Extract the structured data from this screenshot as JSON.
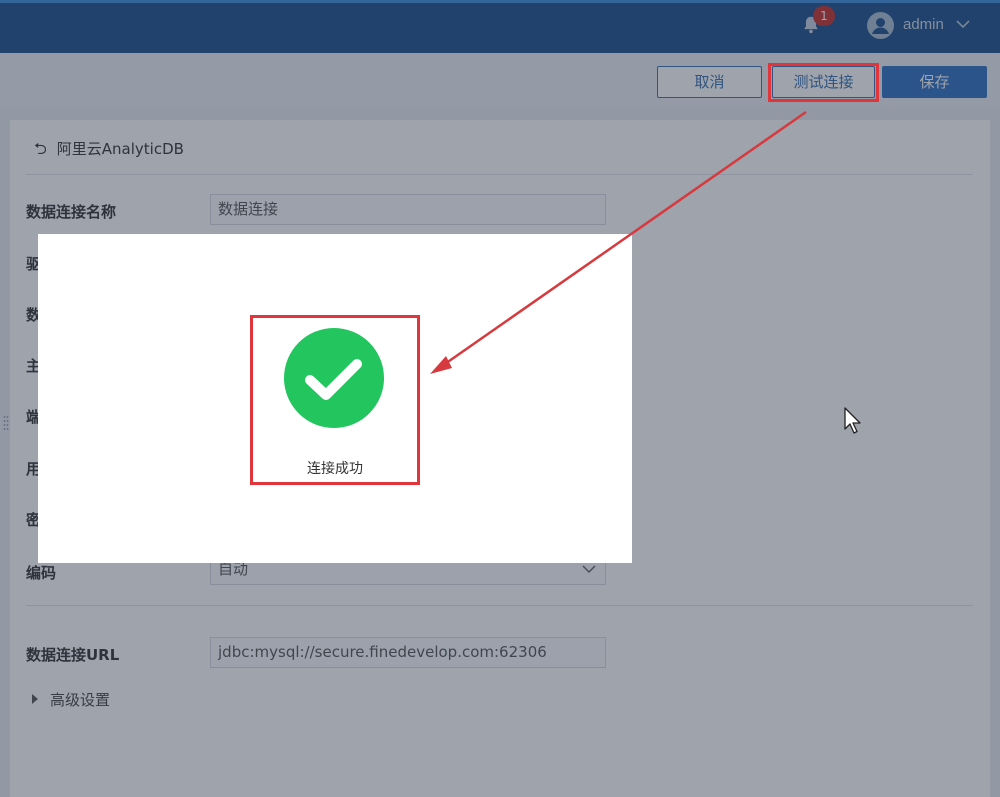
{
  "header": {
    "notification_count": "1",
    "username": "admin",
    "icons": {
      "bell": "bell-icon",
      "avatar": "user-avatar-icon",
      "chevron": "chevron-down-icon"
    }
  },
  "actions": {
    "cancel_label": "取消",
    "test_label": "测试连接",
    "save_label": "保存"
  },
  "form": {
    "back_label": "阿里云AnalyticDB",
    "name_label": "数据连接名称",
    "name_value": "数据连接",
    "partial_labels": [
      "驱",
      "数",
      "主",
      "端",
      "用",
      "密"
    ],
    "encoding_label": "编码",
    "encoding_value": "自动",
    "url_label": "数据连接URL",
    "url_value": "jdbc:mysql://secure.finedevelop.com:62306",
    "advanced_label": "高级设置"
  },
  "modal": {
    "status_text": "连接成功",
    "status_icon": "check-circle-icon"
  },
  "colors": {
    "header_bg": "#1a4f8a",
    "primary": "#2f6fc4",
    "success": "#22c55e",
    "annotation": "#e0353a"
  }
}
